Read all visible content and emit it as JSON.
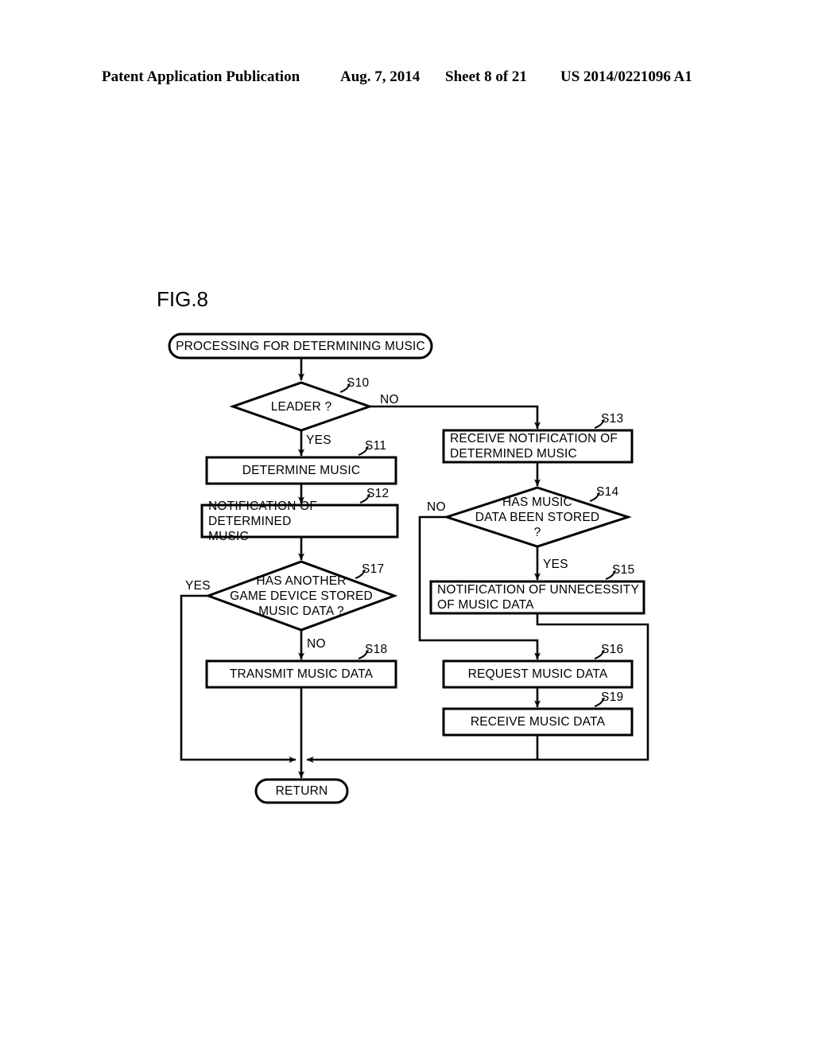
{
  "header": {
    "publication": "Patent Application Publication",
    "date": "Aug. 7, 2014",
    "sheet": "Sheet 8 of 21",
    "patent_number": "US 2014/0221096 A1"
  },
  "figure": {
    "label": "FIG.8"
  },
  "flowchart": {
    "start": {
      "text": "PROCESSING FOR DETERMINING MUSIC"
    },
    "end": {
      "text": "RETURN"
    },
    "nodes": [
      {
        "step": "S10",
        "shape": "decision",
        "text": "LEADER ?"
      },
      {
        "step": "S11",
        "shape": "process",
        "text": "DETERMINE MUSIC"
      },
      {
        "step": "S12",
        "shape": "process",
        "text": "NOTIFICATION OF DETERMINED\nMUSIC"
      },
      {
        "step": "S17",
        "shape": "decision",
        "text": "HAS ANOTHER\nGAME DEVICE STORED\nMUSIC DATA ?"
      },
      {
        "step": "S18",
        "shape": "process",
        "text": "TRANSMIT MUSIC DATA"
      },
      {
        "step": "S13",
        "shape": "process",
        "text": "RECEIVE NOTIFICATION OF\nDETERMINED MUSIC"
      },
      {
        "step": "S14",
        "shape": "decision",
        "text": "HAS MUSIC\nDATA BEEN STORED\n?"
      },
      {
        "step": "S15",
        "shape": "process",
        "text": "NOTIFICATION OF UNNECESSITY\nOF MUSIC DATA"
      },
      {
        "step": "S16",
        "shape": "process",
        "text": "REQUEST MUSIC DATA"
      },
      {
        "step": "S19",
        "shape": "process",
        "text": "RECEIVE MUSIC DATA"
      }
    ],
    "branches": {
      "s10_no": "NO",
      "s10_yes": "YES",
      "s17_yes": "YES",
      "s17_no": "NO",
      "s14_no": "NO",
      "s14_yes": "YES"
    },
    "colors": {
      "stroke": "#000000",
      "background": "#ffffff"
    }
  }
}
